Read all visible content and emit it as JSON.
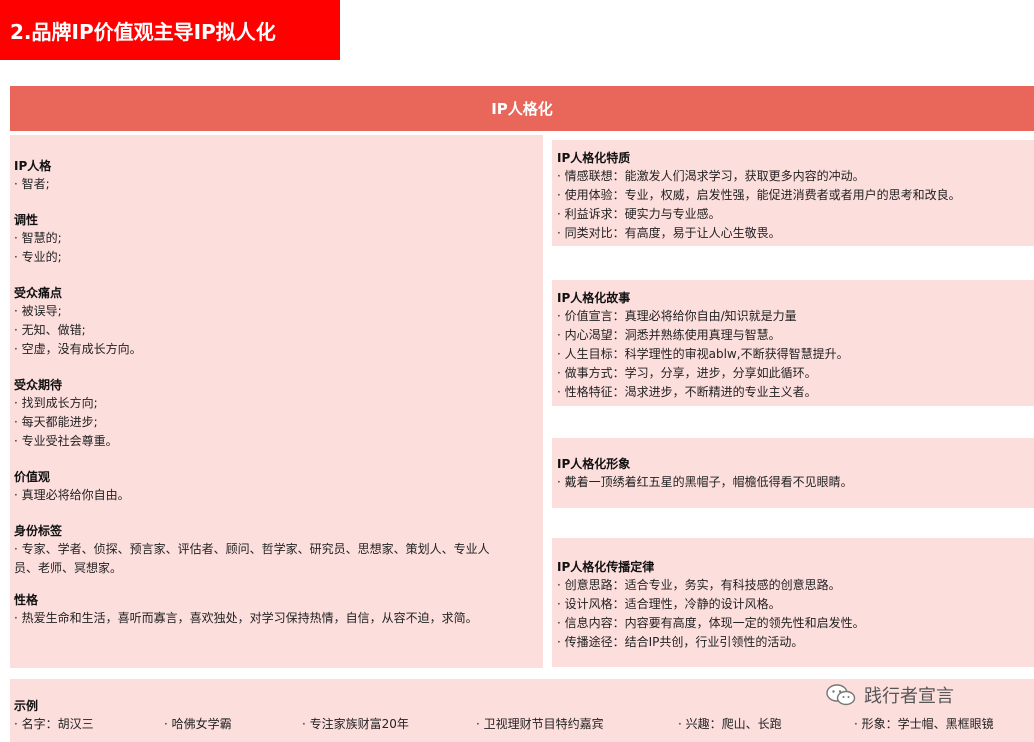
{
  "page_title": "2.品牌IP价值观主导IP拟人化",
  "header": "IP人格化",
  "left_sections": [
    {
      "heading": "IP人格",
      "lines": [
        "· 智者;"
      ]
    },
    {
      "heading": "调性",
      "lines": [
        "· 智慧的;",
        "· 专业的;"
      ]
    },
    {
      "heading": "受众痛点",
      "lines": [
        "· 被误导;",
        "· 无知、做错;",
        "· 空虚，没有成长方向。"
      ]
    },
    {
      "heading": "受众期待",
      "lines": [
        "· 找到成长方向;",
        "· 每天都能进步;",
        "· 专业受社会尊重。"
      ]
    },
    {
      "heading": "价值观",
      "lines": [
        "· 真理必将给你自由。"
      ]
    },
    {
      "heading": "身份标签",
      "lines": [
        "· 专家、学者、侦探、预言家、评估者、顾问、哲学家、研究员、思想家、策划人、专业人",
        "员、老师、冥想家。"
      ]
    },
    {
      "heading": "性格",
      "lines": [
        "· 热爱生命和生活，喜听而寡言，喜欢独处，对学习保持热情，自信，从容不迫，求简。"
      ]
    }
  ],
  "right_boxes": [
    {
      "heading": "IP人格化特质",
      "lines": [
        "· 情感联想：能激发人们渴求学习，获取更多内容的冲动。",
        "· 使用体验：专业，权威，启发性强，能促进消费者或者用户的思考和改良。",
        "· 利益诉求：硬实力与专业感。",
        "· 同类对比：有高度，易于让人心生敬畏。"
      ]
    },
    {
      "heading": "IP人格化故事",
      "lines": [
        "· 价值宣言：真理必将给你自由/知识就是力量",
        "· 内心渴望：洞悉并熟练使用真理与智慧。",
        "· 人生目标：科学理性的审视ablw,不断获得智慧提升。",
        "· 做事方式：学习，分享，进步，分享如此循环。",
        "· 性格特征：渴求进步，不断精进的专业主义者。"
      ]
    },
    {
      "heading": "IP人格化形象",
      "lines": [
        "· 戴着一顶绣着红五星的黑帽子，帽檐低得看不见眼睛。"
      ]
    },
    {
      "heading": "IP人格化传播定律",
      "lines": [
        "· 创意思路：适合专业，务实，有科技感的创意思路。",
        "· 设计风格：适合理性，冷静的设计风格。",
        "· 信息内容：内容要有高度，体现一定的领先性和启发性。",
        "· 传播途径：结合IP共创，行业引领性的活动。"
      ]
    }
  ],
  "example": {
    "heading": "示例",
    "items": [
      "· 名字：胡汉三",
      "· 哈佛女学霸",
      "· 专注家族财富20年",
      "· 卫视理财节目特约嘉宾",
      "· 兴趣：爬山、长跑",
      "· 形象：学士帽、黑框眼镜"
    ]
  },
  "watermark": "践行者宣言",
  "colors": {
    "title_bg": "#ff0000",
    "header_bg": "#e8675a",
    "panel_bg": "#fcdedd"
  }
}
